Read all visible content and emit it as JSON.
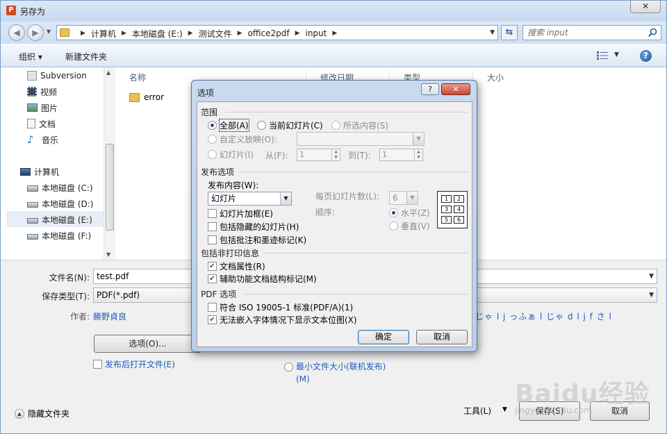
{
  "window": {
    "title": "另存为",
    "app_icon_letter": "P",
    "close_glyph": "✕"
  },
  "address": {
    "crumbs": [
      "计算机",
      "本地磁盘 (E:)",
      "测试文件",
      "office2pdf",
      "input"
    ],
    "search_placeholder": "搜索 input"
  },
  "toolbar": {
    "organize_label": "组织 ▾",
    "new_folder_label": "新建文件夹",
    "help_glyph": "?"
  },
  "nav": {
    "favorites": [
      {
        "label": "Subversion",
        "icon": "subversion-icon"
      },
      {
        "label": "视频",
        "icon": "video-icon"
      },
      {
        "label": "图片",
        "icon": "pictures-icon"
      },
      {
        "label": "文档",
        "icon": "documents-icon"
      },
      {
        "label": "音乐",
        "icon": "music-icon"
      }
    ],
    "computer_label": "计算机",
    "drives": [
      {
        "label": "本地磁盘 (C:)"
      },
      {
        "label": "本地磁盘 (D:)"
      },
      {
        "label": "本地磁盘 (E:)"
      },
      {
        "label": "本地磁盘 (F:)"
      }
    ],
    "selected_drive": "本地磁盘 (E:)"
  },
  "files": {
    "columns": [
      "名称",
      "修改日期",
      "类型",
      "大小"
    ],
    "rows": [
      {
        "name": "error"
      }
    ]
  },
  "form": {
    "filename_label": "文件名(N):",
    "filename_value": "test.pdf",
    "savetype_label": "保存类型(T):",
    "savetype_value": "PDF(*.pdf)",
    "author_label": "作者:",
    "author_value": "勝野貞良",
    "author_extra": "じゃ l j っふぁ l じゃ d l j f さ l",
    "options_button": "选项(O)...",
    "open_after_label": "发布后打开文件(E)",
    "min_size_label": "最小文件大小(联机发布)(M)",
    "hide_folders_label": "隐藏文件夹",
    "tools_label": "工具(L)",
    "save_button": "保存(S)",
    "cancel_button": "取消"
  },
  "watermark": {
    "logo": "Baidu经验",
    "url": "jingyan.baidu.com"
  },
  "dialog": {
    "title": "选项",
    "help_glyph": "?",
    "close_glyph": "✕",
    "range": {
      "title": "范围",
      "all": "全部(A)",
      "current": "当前幻灯片(C)",
      "selection": "所选内容(S)",
      "custom": "自定义放映(O):",
      "slides": "幻灯片(I)",
      "from_label": "从(F):",
      "from_value": "1",
      "to_label": "到(T):",
      "to_value": "1"
    },
    "publish": {
      "title": "发布选项",
      "content_label": "发布内容(W):",
      "content_value": "幻灯片",
      "per_page_label": "每页幻灯片数(L):",
      "per_page_value": "6",
      "order_label": "顺序:",
      "horizontal": "水平(Z)",
      "vertical": "垂直(V)",
      "frame": "幻灯片加框(E)",
      "hidden": "包括隐藏的幻灯片(H)",
      "comments": "包括批注和墨迹标记(K)",
      "grid_numbers": [
        "1",
        "2",
        "3",
        "4",
        "5",
        "6"
      ]
    },
    "nonprint": {
      "title": "包括非打印信息",
      "doc_props": "文档属性(R)",
      "doc_structure": "辅助功能文档结构标记(M)"
    },
    "pdf": {
      "title": "PDF 选项",
      "iso": "符合 ISO 19005-1 标准(PDF/A)(1)",
      "bitmap": "无法嵌入字体情况下显示文本位图(X)"
    },
    "ok_button": "确定",
    "cancel_button": "取消"
  }
}
